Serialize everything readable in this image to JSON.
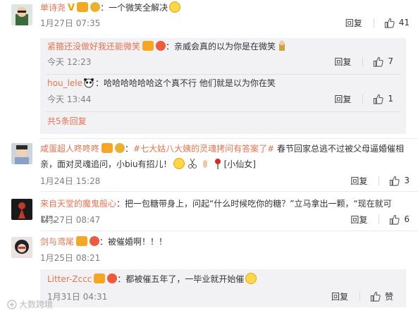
{
  "like_icon": "thumbs-up-icon",
  "reply_label": "回复",
  "comments": [
    {
      "username": "单诗尧",
      "text": "：一个微笑全解决",
      "time": "1月27日 07:35",
      "likes": "41",
      "replies": [
        {
          "username": "紧箍还没做好我还能微笑",
          "text": "：亲威会真的以为你是在微笑",
          "time": "今天 12:23",
          "likes": "7"
        },
        {
          "username": "hou_lele",
          "text": "：哈哈哈哈哈哈这个真不行 他们就是以为你在笑",
          "time": "今天 13:44",
          "likes": "1"
        }
      ],
      "more_replies": "共5条回复"
    },
    {
      "username": "咸蛋超人咚咚咚",
      "topic": "#七大姑八大姨的灵魂拷问有答案了#",
      "text_line1": " 春节回家总逃不过被父母逼婚催相",
      "text_line2": "亲，面对灵魂追问，小biu有招儿！",
      "tag": "[小仙女]",
      "time": "1月24日 15:28",
      "likes": "3"
    },
    {
      "username": "来自天堂的魔鬼般心",
      "text": "：把一包糖带身上，问起“什么时候吃你的糖？”立马拿出一颗，“现在就可以”。",
      "time": "1月27日 08:47",
      "likes": "6"
    },
    {
      "username": "剑与鸢尾",
      "text": "：被催婚啊！！！",
      "time": "1月25日 08:21",
      "likes": "",
      "replies": [
        {
          "username": "Litter-Zccc",
          "text": "：都被催五年了，一毕业就开始催",
          "time": "1月31日 04:31",
          "likes": "赞"
        }
      ]
    }
  ],
  "watermark": "大数跨境"
}
